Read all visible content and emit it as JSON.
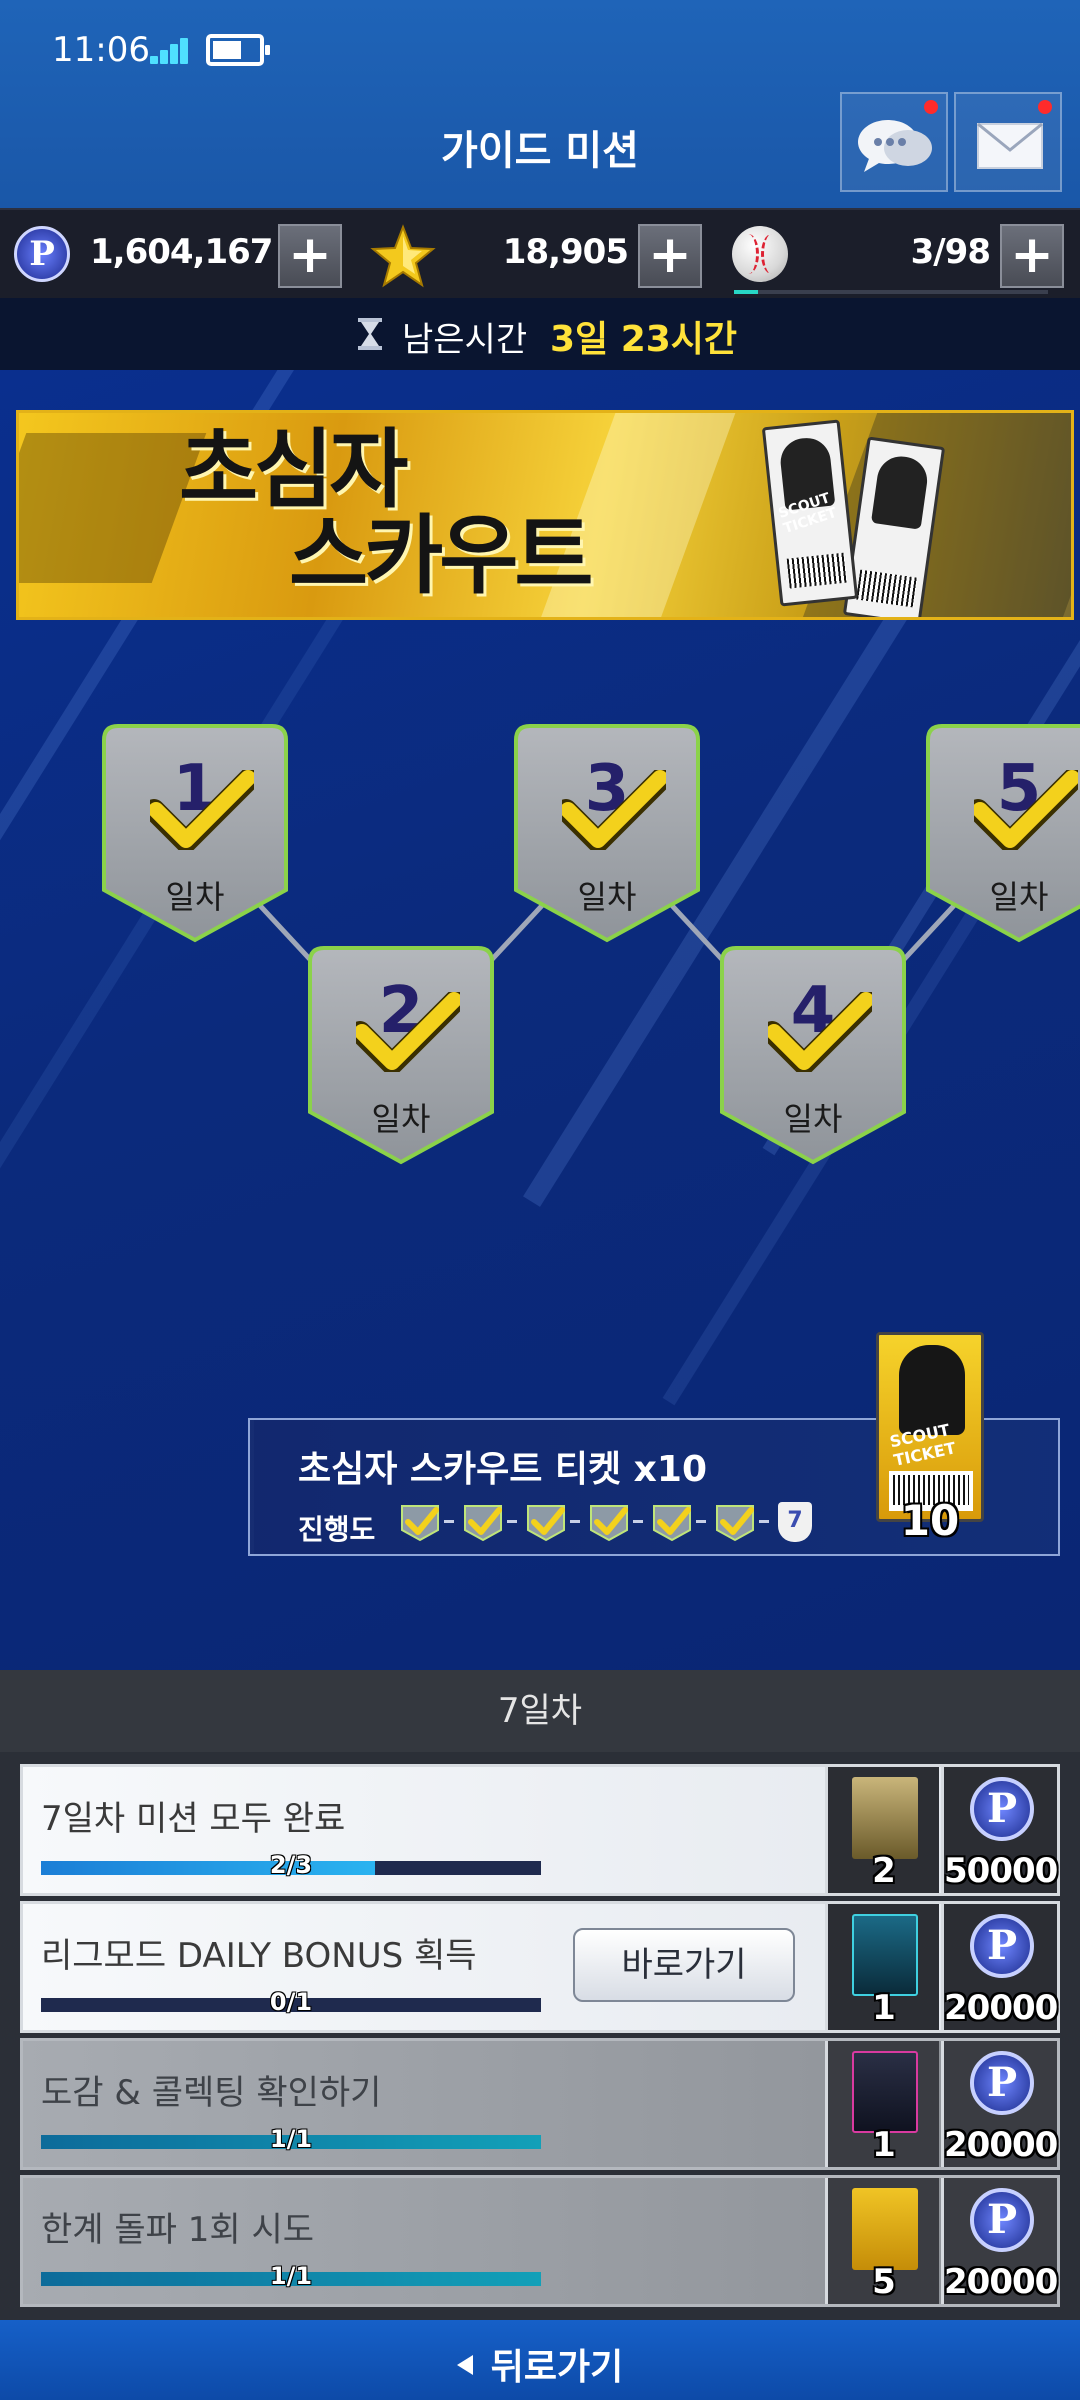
{
  "status_bar": {
    "time": "11:06"
  },
  "header": {
    "title": "가이드 미션",
    "chat_icon": "chat-bubbles-icon",
    "mail_icon": "mail-envelope-icon"
  },
  "currency": {
    "points": "1,604,167",
    "stars": "18,905",
    "balls": "3/98"
  },
  "timer": {
    "label": "남은시간",
    "value": "3일 23시간"
  },
  "banner": {
    "line1": "초심자",
    "line2": "스카우트",
    "ticket_text": "SCOUT TICKET"
  },
  "days": [
    {
      "num": "1",
      "label": "일차",
      "completed": true
    },
    {
      "num": "2",
      "label": "일차",
      "completed": true
    },
    {
      "num": "3",
      "label": "일차",
      "completed": true
    },
    {
      "num": "4",
      "label": "일차",
      "completed": true
    },
    {
      "num": "5",
      "label": "일차",
      "completed": true
    }
  ],
  "reward": {
    "title": "초심자 스카우트 티켓 x10",
    "progress_label": "진행도",
    "completed_steps": 6,
    "current_step": "7",
    "ticket_text": "SCOUT TICKET",
    "count": "10"
  },
  "mission_day": "7일차",
  "missions": [
    {
      "text": "7일차 미션 모두 완료",
      "progress": "2/3",
      "fraction": 0.667,
      "state": "active",
      "item_count": "2",
      "points": "50000"
    },
    {
      "text": "리그모드 DAILY BONUS 획득",
      "progress": "0/1",
      "fraction": 0,
      "state": "active",
      "button": "바로가기",
      "item_count": "1",
      "points": "20000"
    },
    {
      "text": "도감 & 콜렉팅 확인하기",
      "progress": "1/1",
      "fraction": 1,
      "state": "done",
      "item_count": "1",
      "points": "20000"
    },
    {
      "text": "한계 돌파 1회 시도",
      "progress": "1/1",
      "fraction": 1,
      "state": "done",
      "item_count": "5",
      "points": "20000"
    }
  ],
  "footer": {
    "back_label": "뒤로가기"
  },
  "colors": {
    "accent_yellow": "#ffe23a",
    "nav_blue": "#1a57a8",
    "check_yellow": "#f3d11c",
    "node_green": "#8bd24a"
  }
}
